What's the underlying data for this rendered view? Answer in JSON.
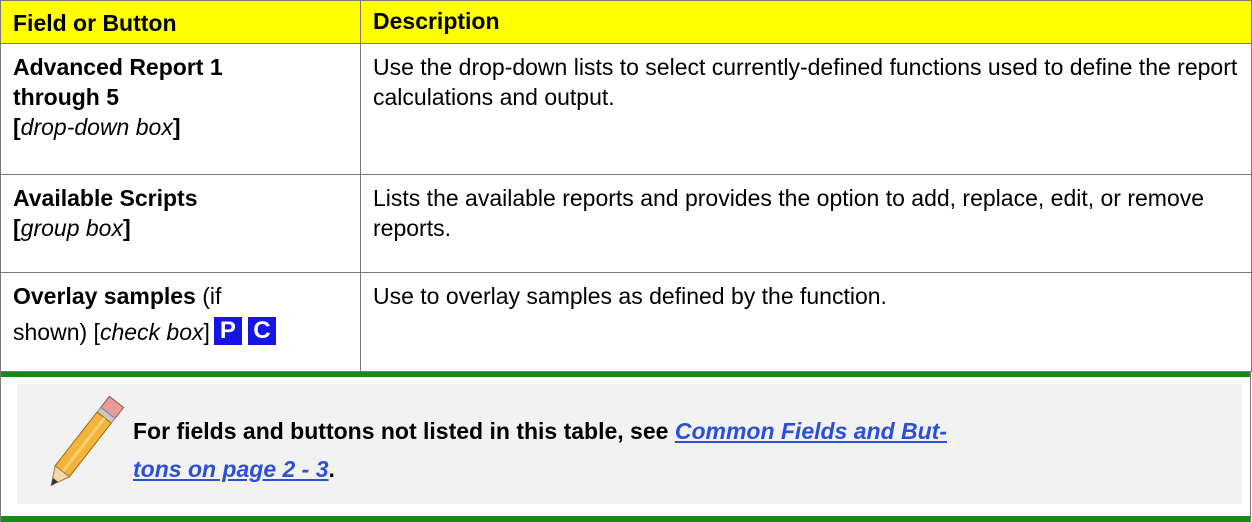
{
  "table": {
    "header": {
      "col1": "Field or Button",
      "col2": "Description"
    },
    "rows": [
      {
        "name_lines": [
          "Advanced Report 1",
          "through 5"
        ],
        "type_open": "[",
        "type": "drop-down box",
        "type_close": "]",
        "description": "Use the drop-down lists to select currently-defined functions used to define the report calculations and output."
      },
      {
        "name_lines": [
          "Available Scripts"
        ],
        "type_open": "[",
        "type": "group box",
        "type_close": "]",
        "description": "Lists the available reports and provides the option to add, replace, edit, or remove reports."
      },
      {
        "name": "Overlay samples",
        "qualifier_a": " (if",
        "qualifier_b": "shown) [",
        "type": "check box",
        "type_close": "]",
        "badges": [
          "P",
          "C"
        ],
        "description": "Use to overlay samples as defined by the function."
      }
    ]
  },
  "note": {
    "icon": "pencil-icon",
    "text": "For fields and buttons not listed in this table, see ",
    "link_line1": "Common Fields and But-",
    "link_line2": "tons on page 2 - 3",
    "text_end": "."
  },
  "colors": {
    "header_bg": "#ffff00",
    "note_bar": "#138d13",
    "note_bg": "#f2f2f2",
    "badge_bg": "#1515e6",
    "link": "#2b4fd6"
  }
}
